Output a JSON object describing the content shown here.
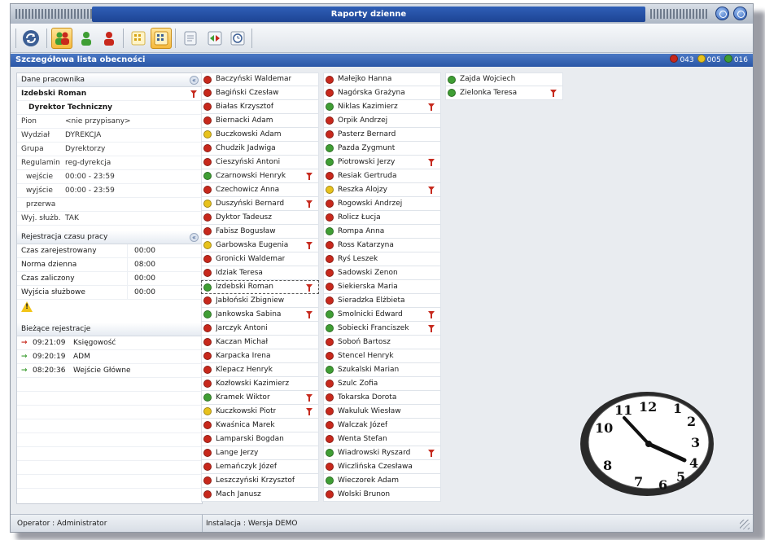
{
  "window": {
    "title": "Raporty dzienne"
  },
  "section": {
    "title": "Szczegółowa lista obecności",
    "stats": [
      {
        "color": "#c8281c",
        "value": "043"
      },
      {
        "color": "#e8c21c",
        "value": "005"
      },
      {
        "color": "#3f9e34",
        "value": "016"
      }
    ]
  },
  "toolbar": {
    "buttons": [
      {
        "icon": "refresh-icon"
      },
      {
        "icon": "group-icon"
      },
      {
        "icon": "person-green-icon"
      },
      {
        "icon": "person-red-icon"
      },
      {
        "icon": "grid-icon"
      },
      {
        "icon": "report-icon"
      },
      {
        "icon": "document-icon"
      },
      {
        "icon": "arrows-icon"
      },
      {
        "icon": "clock-icon"
      }
    ]
  },
  "employee_panel": {
    "header": "Dane pracownika",
    "name": "Izdebski Roman",
    "role": "Dyrektor Techniczny",
    "fields": [
      {
        "key": "Pion",
        "value": "<nie przypisany>"
      },
      {
        "key": "Wydział",
        "value": "DYREKCJA"
      },
      {
        "key": "Grupa",
        "value": "Dyrektorzy"
      },
      {
        "key": "Regulamin",
        "value": "reg-dyrekcja"
      },
      {
        "key": "wejście",
        "value": "00:00 - 23:59"
      },
      {
        "key": "wyjście",
        "value": "00:00 - 23:59"
      },
      {
        "key": "przerwa",
        "value": ""
      },
      {
        "key": "Wyj. służb.",
        "value": "TAK"
      }
    ]
  },
  "time_panel": {
    "header": "Rejestracja czasu pracy",
    "rows": [
      {
        "key": "Czas zarejestrowany",
        "value": "00:00"
      },
      {
        "key": "Norma dzienna",
        "value": "08:00"
      },
      {
        "key": "Czas zaliczony",
        "value": "00:00"
      },
      {
        "key": "Wyjścia służbowe",
        "value": "00:00"
      }
    ]
  },
  "registrations": {
    "header": "Bieżące rejestracje",
    "rows": [
      {
        "arrow": "→",
        "color": "#c8281c",
        "time": "09:21:09",
        "place": "Księgowość"
      },
      {
        "arrow": "→",
        "color": "#3f9e34",
        "time": "09:20:19",
        "place": "ADM"
      },
      {
        "arrow": "→",
        "color": "#3f9e34",
        "time": "08:20:36",
        "place": "Wejście Główne"
      }
    ]
  },
  "employees": [
    [
      {
        "name": "Baczyński Waldemar",
        "status": "red",
        "flag": false
      },
      {
        "name": "Bagiński Czesław",
        "status": "red",
        "flag": false
      },
      {
        "name": "Białas Krzysztof",
        "status": "red",
        "flag": false
      },
      {
        "name": "Biernacki Adam",
        "status": "red",
        "flag": false
      },
      {
        "name": "Buczkowski Adam",
        "status": "yellow",
        "flag": false
      },
      {
        "name": "Chudzik Jadwiga",
        "status": "red",
        "flag": false
      },
      {
        "name": "Cieszyński Antoni",
        "status": "red",
        "flag": false
      },
      {
        "name": "Czarnowski Henryk",
        "status": "green",
        "flag": true
      },
      {
        "name": "Czechowicz Anna",
        "status": "red",
        "flag": false
      },
      {
        "name": "Duszyński Bernard",
        "status": "yellow",
        "flag": true
      },
      {
        "name": "Dyktor Tadeusz",
        "status": "red",
        "flag": false
      },
      {
        "name": "Fabisz Bogusław",
        "status": "red",
        "flag": false
      },
      {
        "name": "Garbowska Eugenia",
        "status": "yellow",
        "flag": true
      },
      {
        "name": "Gronicki Waldemar",
        "status": "red",
        "flag": false
      },
      {
        "name": "Idziak Teresa",
        "status": "red",
        "flag": false
      },
      {
        "name": "Izdebski Roman",
        "status": "green",
        "flag": true,
        "selected": true
      },
      {
        "name": "Jabłoński Zbigniew",
        "status": "red",
        "flag": false
      },
      {
        "name": "Jankowska Sabina",
        "status": "green",
        "flag": true
      },
      {
        "name": "Jarczyk Antoni",
        "status": "red",
        "flag": false
      },
      {
        "name": "Kaczan Michał",
        "status": "red",
        "flag": false
      },
      {
        "name": "Karpacka Irena",
        "status": "red",
        "flag": false
      },
      {
        "name": "Klepacz Henryk",
        "status": "red",
        "flag": false
      },
      {
        "name": "Kozłowski Kazimierz",
        "status": "red",
        "flag": false
      },
      {
        "name": "Kramek Wiktor",
        "status": "green",
        "flag": true
      },
      {
        "name": "Kuczkowski Piotr",
        "status": "yellow",
        "flag": true
      },
      {
        "name": "Kwaśnica Marek",
        "status": "red",
        "flag": false
      },
      {
        "name": "Lamparski Bogdan",
        "status": "red",
        "flag": false
      },
      {
        "name": "Lange Jerzy",
        "status": "red",
        "flag": false
      },
      {
        "name": "Lemańczyk Józef",
        "status": "red",
        "flag": false
      },
      {
        "name": "Leszczyński Krzysztof",
        "status": "red",
        "flag": false
      },
      {
        "name": "Mach Janusz",
        "status": "red",
        "flag": false
      }
    ],
    [
      {
        "name": "Małejko Hanna",
        "status": "red",
        "flag": false
      },
      {
        "name": "Nagórska Grażyna",
        "status": "red",
        "flag": false
      },
      {
        "name": "Niklas Kazimierz",
        "status": "green",
        "flag": true
      },
      {
        "name": "Orpik Andrzej",
        "status": "red",
        "flag": false
      },
      {
        "name": "Pasterz Bernard",
        "status": "red",
        "flag": false
      },
      {
        "name": "Pazda Zygmunt",
        "status": "green",
        "flag": false
      },
      {
        "name": "Piotrowski Jerzy",
        "status": "green",
        "flag": true
      },
      {
        "name": "Resiak Gertruda",
        "status": "red",
        "flag": false
      },
      {
        "name": "Reszka Alojzy",
        "status": "yellow",
        "flag": true
      },
      {
        "name": "Rogowski Andrzej",
        "status": "red",
        "flag": false
      },
      {
        "name": "Rolicz Łucja",
        "status": "red",
        "flag": false
      },
      {
        "name": "Rompa Anna",
        "status": "green",
        "flag": false
      },
      {
        "name": "Ross Katarzyna",
        "status": "red",
        "flag": false
      },
      {
        "name": "Ryś Leszek",
        "status": "red",
        "flag": false
      },
      {
        "name": "Sadowski Zenon",
        "status": "red",
        "flag": false
      },
      {
        "name": "Siekierska Maria",
        "status": "red",
        "flag": false
      },
      {
        "name": "Sieradzka Elżbieta",
        "status": "red",
        "flag": false
      },
      {
        "name": "Smolnicki Edward",
        "status": "green",
        "flag": true
      },
      {
        "name": "Sobiecki Franciszek",
        "status": "green",
        "flag": true
      },
      {
        "name": "Soboń Bartosz",
        "status": "red",
        "flag": false
      },
      {
        "name": "Stencel Henryk",
        "status": "red",
        "flag": false
      },
      {
        "name": "Szukalski Marian",
        "status": "green",
        "flag": false
      },
      {
        "name": "Szulc Zofia",
        "status": "red",
        "flag": false
      },
      {
        "name": "Tokarska Dorota",
        "status": "red",
        "flag": false
      },
      {
        "name": "Wakuluk Wiesław",
        "status": "red",
        "flag": false
      },
      {
        "name": "Walczak Józef",
        "status": "red",
        "flag": false
      },
      {
        "name": "Wenta Stefan",
        "status": "red",
        "flag": false
      },
      {
        "name": "Wiadrowski Ryszard",
        "status": "green",
        "flag": true
      },
      {
        "name": "Wiczlińska Czesława",
        "status": "red",
        "flag": false
      },
      {
        "name": "Wieczorek Adam",
        "status": "green",
        "flag": false
      },
      {
        "name": "Wolski Brunon",
        "status": "red",
        "flag": false
      }
    ],
    [
      {
        "name": "Zajda Wojciech",
        "status": "green",
        "flag": false
      },
      {
        "name": "Zielonka Teresa",
        "status": "green",
        "flag": true
      }
    ]
  ],
  "clock": {
    "numerals": [
      "12",
      "1",
      "2",
      "3",
      "4",
      "5",
      "6",
      "7",
      "8",
      "10",
      "11"
    ]
  },
  "status_colors": {
    "red": "#c8281c",
    "yellow": "#e8c21c",
    "green": "#3f9e34"
  },
  "statusbar": {
    "operator": "Operator : Administrator",
    "install": "Instalacja : Wersja DEMO"
  }
}
